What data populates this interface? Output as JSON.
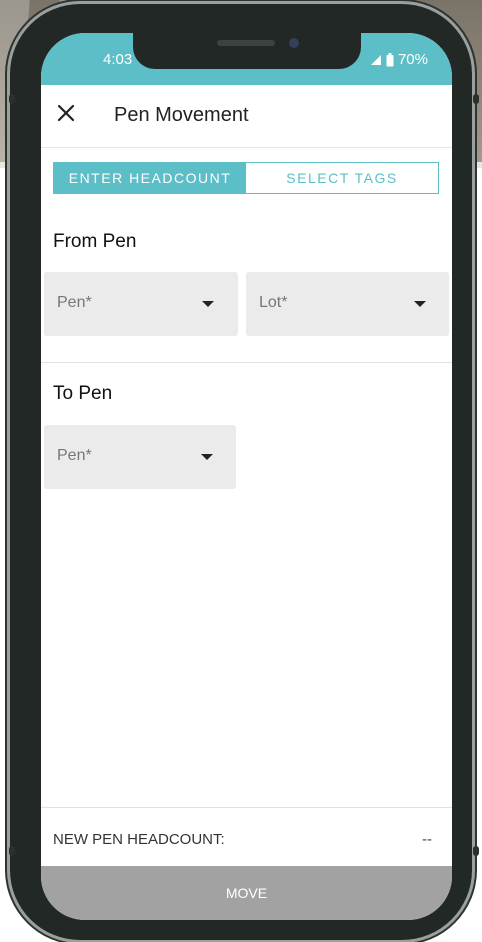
{
  "status_bar": {
    "time": "4:03",
    "battery": "70%"
  },
  "app_bar": {
    "title": "Pen Movement"
  },
  "tabs": [
    {
      "label": "ENTER HEADCOUNT",
      "active": true
    },
    {
      "label": "SELECT TAGS",
      "active": false
    }
  ],
  "from_pen": {
    "title": "From Pen",
    "pen_placeholder": "Pen*",
    "lot_placeholder": "Lot*"
  },
  "to_pen": {
    "title": "To Pen",
    "pen_placeholder": "Pen*"
  },
  "footer": {
    "headcount_label": "NEW PEN HEADCOUNT:",
    "headcount_value": "--"
  },
  "actions": {
    "move_label": "MOVE"
  },
  "colors": {
    "accent": "#5cbfc7",
    "button_disabled": "#a2a2a2",
    "field_bg": "#ebebeb"
  }
}
